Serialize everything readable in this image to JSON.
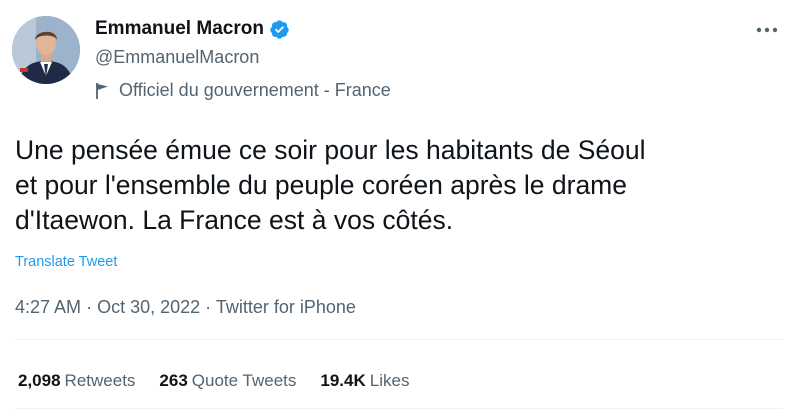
{
  "author": {
    "display_name": "Emmanuel Macron",
    "handle": "@EmmanuelMacron",
    "label": "Officiel du gouvernement - France",
    "verified_icon": "verified-badge-icon",
    "verified_color": "#1d9bf0"
  },
  "tweet": {
    "text": "Une pensée émue ce soir pour les habitants de Séoul\net pour l'ensemble du peuple coréen après le drame\nd'Itaewon. La France est à vos côtés.",
    "translate_label": "Translate Tweet",
    "time": "4:27 AM",
    "date": "Oct 30, 2022",
    "source": "Twitter for iPhone",
    "separator": "·"
  },
  "stats": {
    "retweets_count": "2,098",
    "retweets_label": "Retweets",
    "quotes_count": "263",
    "quotes_label": "Quote Tweets",
    "likes_count": "19.4K",
    "likes_label": "Likes"
  },
  "icons": {
    "more": "more-horizontal-icon",
    "label": "flag-icon"
  },
  "colors": {
    "accent": "#1d9bf0",
    "text_primary": "#0f1419",
    "text_secondary": "#536471",
    "divider": "#eff3f4"
  }
}
